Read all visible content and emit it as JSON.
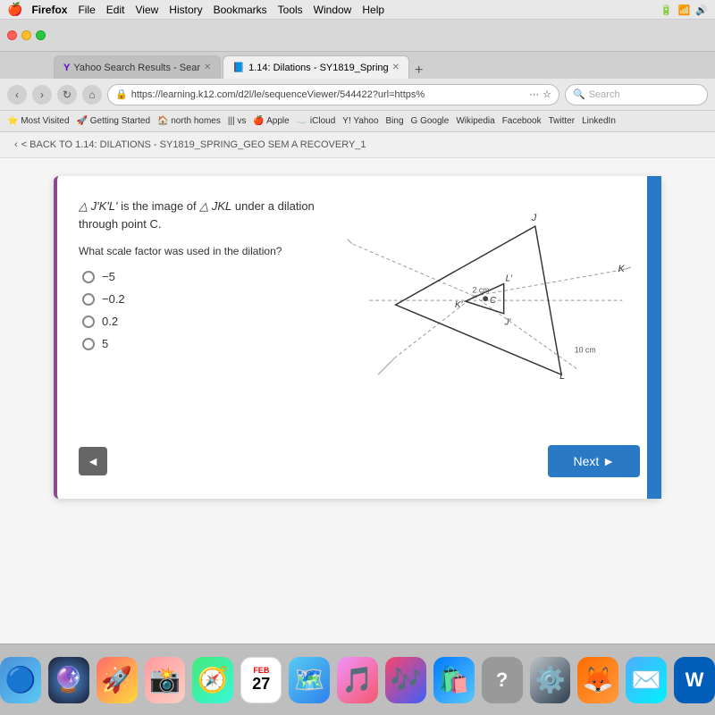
{
  "macOS": {
    "menuBar": {
      "apple": "⌘",
      "items": [
        "Firefox",
        "File",
        "Edit",
        "View",
        "History",
        "Bookmarks",
        "Tools",
        "Window",
        "Help"
      ]
    }
  },
  "browser": {
    "tabs": [
      {
        "id": "tab-yahoo",
        "label": "Yahoo Search Results - Sear",
        "active": false,
        "favicon": "Y"
      },
      {
        "id": "tab-dilations",
        "label": "1.14: Dilations - SY1819_Spring",
        "active": true,
        "favicon": "📘"
      }
    ],
    "url": "https://learning.k12.com/d2l/le/sequenceViewer/544422?url=https%",
    "searchPlaceholder": "Search",
    "bookmarks": [
      "Most Visited",
      "Getting Started",
      "north homes",
      "vs",
      "Apple",
      "iCloud",
      "Yahoo",
      "Bing",
      "G Google",
      "Wikipedia",
      "Facebook",
      "Twitter",
      "LinkedIn"
    ]
  },
  "page": {
    "backNav": "< BACK TO 1.14: DILATIONS - SY1819_SPRING_GEO SEM A RECOVERY_1"
  },
  "question": {
    "statement_part1": "△ J'K'L'",
    "statement_part2": "is the image of",
    "statement_part3": "△ JKL",
    "statement_part4": "under a dilation through point C.",
    "subQuestion": "What scale factor was used in the dilation?",
    "options": [
      {
        "id": "opt1",
        "value": "-5",
        "label": "−5"
      },
      {
        "id": "opt2",
        "value": "-0.2",
        "label": "−0.2"
      },
      {
        "id": "opt3",
        "value": "0.2",
        "label": "0.2"
      },
      {
        "id": "opt4",
        "value": "5",
        "label": "5"
      }
    ],
    "diagram": {
      "label2cm": "2 cm",
      "label10cm": "10 cm",
      "labelJ": "J",
      "labelK": "K",
      "labelL": "L",
      "labelJprime": "J'",
      "labelKprime": "K'",
      "labelLprime": "L'",
      "labelC": "C"
    },
    "buttons": {
      "back": "◄",
      "next": "Next ►"
    }
  },
  "dock": {
    "items": [
      {
        "name": "finder",
        "emoji": "🔵",
        "label": "Finder"
      },
      {
        "name": "siri",
        "emoji": "🔮",
        "label": "Siri"
      },
      {
        "name": "launchpad",
        "emoji": "🚀",
        "label": "Launchpad"
      },
      {
        "name": "photos",
        "emoji": "📸",
        "label": "Photos"
      },
      {
        "name": "safari",
        "emoji": "🧭",
        "label": "Safari"
      },
      {
        "name": "calendar",
        "emoji": "📅",
        "label": "Calendar"
      },
      {
        "name": "maps",
        "emoji": "🗺️",
        "label": "Maps"
      },
      {
        "name": "music",
        "emoji": "🎵",
        "label": "Music"
      },
      {
        "name": "itunes",
        "emoji": "🎶",
        "label": "iTunes"
      },
      {
        "name": "appstore",
        "emoji": "🛍️",
        "label": "App Store"
      },
      {
        "name": "question",
        "emoji": "❓",
        "label": "Help"
      },
      {
        "name": "settings",
        "emoji": "⚙️",
        "label": "Settings"
      },
      {
        "name": "firefox",
        "emoji": "🦊",
        "label": "Firefox"
      },
      {
        "name": "mail",
        "emoji": "✉️",
        "label": "Mail"
      },
      {
        "name": "word",
        "emoji": "W",
        "label": "Word"
      }
    ]
  }
}
